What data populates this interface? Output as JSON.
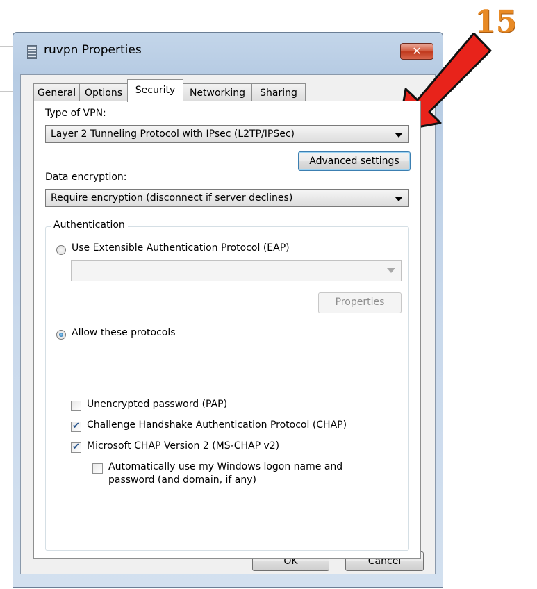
{
  "window": {
    "title": "ruvpn Properties",
    "close_symbol": "✕"
  },
  "tabs": [
    {
      "label": "General"
    },
    {
      "label": "Options"
    },
    {
      "label": "Security"
    },
    {
      "label": "Networking"
    },
    {
      "label": "Sharing"
    }
  ],
  "active_tab": "Security",
  "security": {
    "vpn_type_label": "Type of VPN:",
    "vpn_type_value": "Layer 2 Tunneling Protocol with IPsec (L2TP/IPSec)",
    "advanced_button": "Advanced settings",
    "encryption_label": "Data encryption:",
    "encryption_value": "Require encryption (disconnect if server declines)",
    "auth_group_title": "Authentication",
    "eap_radio_label": "Use Extensible Authentication Protocol (EAP)",
    "eap_combo_value": "",
    "properties_button": "Properties",
    "allow_radio_label": "Allow these protocols",
    "pap_label": "Unencrypted password (PAP)",
    "chap_label": "Challenge Handshake Authentication Protocol (CHAP)",
    "mschap_label": "Microsoft CHAP Version 2 (MS-CHAP v2)",
    "autologon_line1": "Automatically use my Windows logon name and",
    "autologon_line2": "password (and domain, if any)"
  },
  "state": {
    "eap_selected": false,
    "allow_selected": true,
    "pap_checked": false,
    "chap_checked": true,
    "mschap_checked": true,
    "autologon_checked": false
  },
  "footer": {
    "ok_label": "OK",
    "cancel_label": "Cancel"
  },
  "annotation": {
    "step_number": "15",
    "arrow_color": "#e8231b"
  },
  "icons": {
    "window": "network-connection-icon",
    "close": "close-icon",
    "dropdown": "chevron-down-icon"
  }
}
